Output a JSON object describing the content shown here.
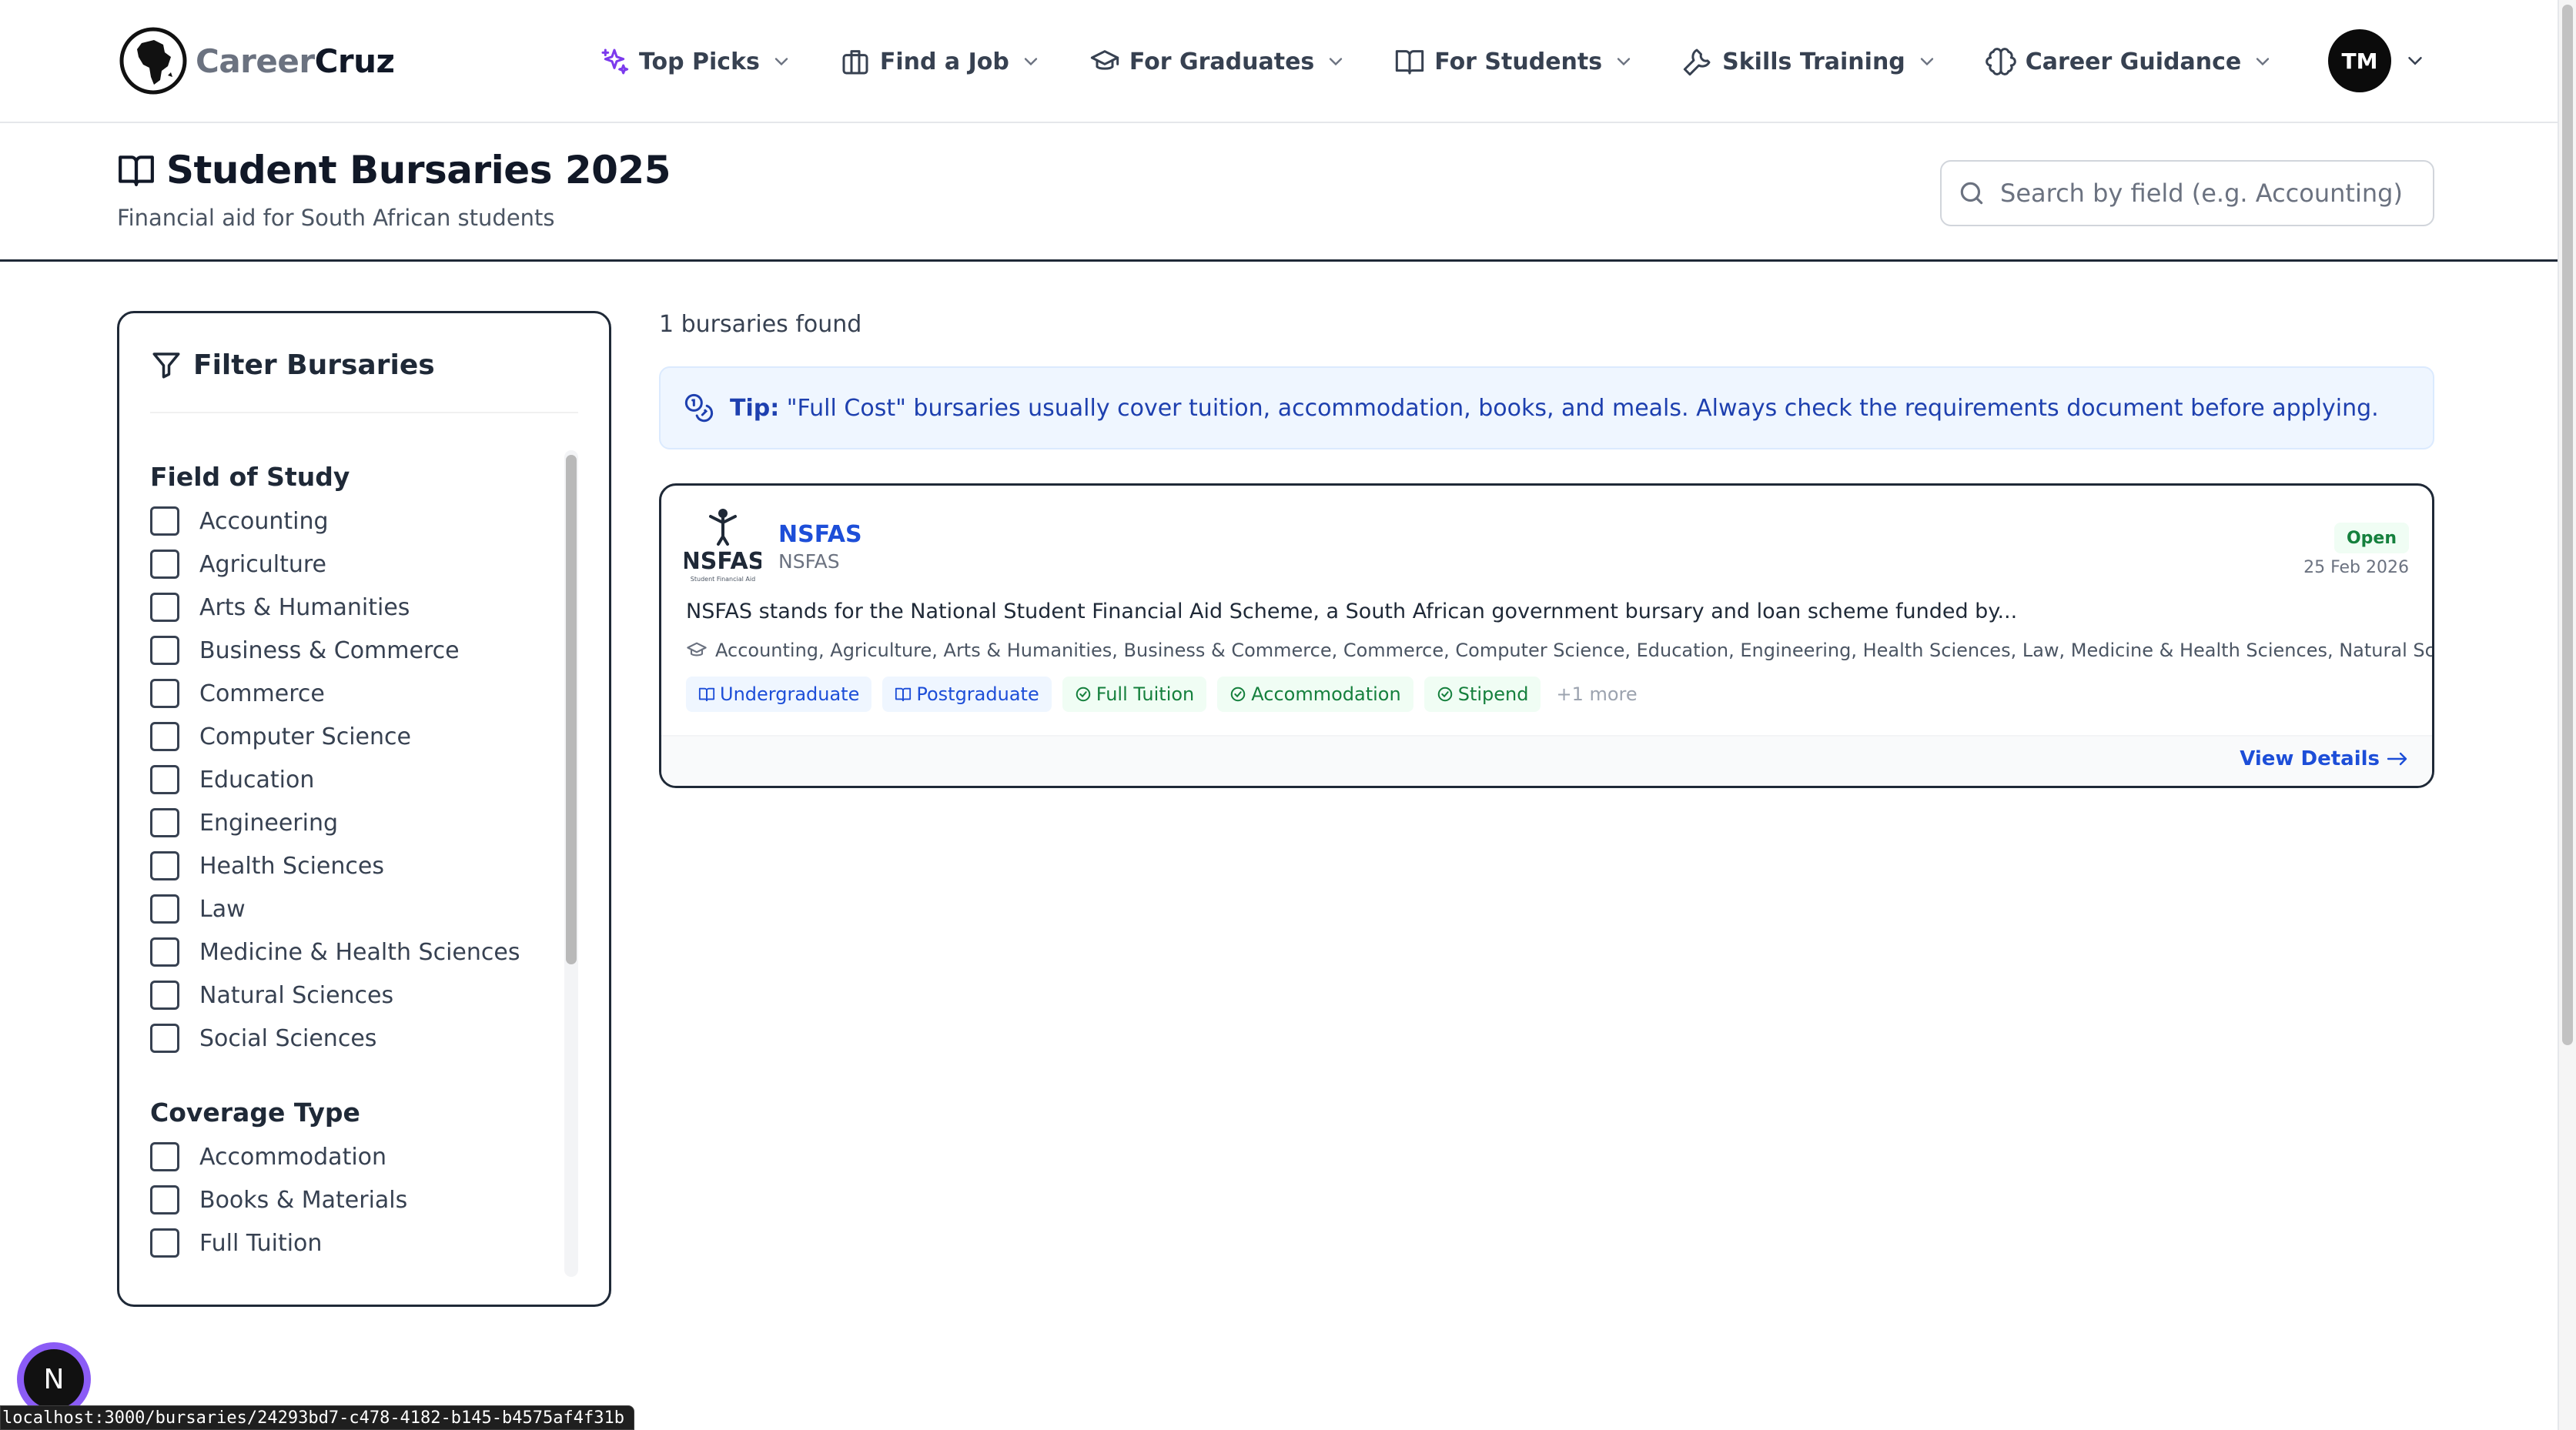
{
  "brand": {
    "name_part1": "Career",
    "name_part2": "Cruz"
  },
  "nav": {
    "items": [
      {
        "label": "Top Picks",
        "icon": "sparkles-icon"
      },
      {
        "label": "Find a Job",
        "icon": "briefcase-icon"
      },
      {
        "label": "For Graduates",
        "icon": "graduation-cap-icon"
      },
      {
        "label": "For Students",
        "icon": "book-open-icon"
      },
      {
        "label": "Skills Training",
        "icon": "wrench-icon"
      },
      {
        "label": "Career Guidance",
        "icon": "brain-icon"
      }
    ]
  },
  "user": {
    "initials": "TM"
  },
  "page": {
    "title": "Student Bursaries 2025",
    "subtitle": "Financial aid for South African students"
  },
  "search": {
    "placeholder": "Search by field (e.g. Accounting)",
    "value": ""
  },
  "filters": {
    "title": "Filter Bursaries",
    "groups": [
      {
        "title": "Field of Study",
        "options": [
          "Accounting",
          "Agriculture",
          "Arts & Humanities",
          "Business & Commerce",
          "Commerce",
          "Computer Science",
          "Education",
          "Engineering",
          "Health Sciences",
          "Law",
          "Medicine & Health Sciences",
          "Natural Sciences",
          "Social Sciences"
        ]
      },
      {
        "title": "Coverage Type",
        "options": [
          "Accommodation",
          "Books & Materials",
          "Full Tuition"
        ]
      }
    ]
  },
  "results": {
    "count_text": "1 bursaries found"
  },
  "tip": {
    "label": "Tip:",
    "text": " \"Full Cost\" bursaries usually cover tuition, accommodation, books, and meals. Always check the requirements document before applying."
  },
  "bursary": {
    "name": "NSFAS",
    "provider": "NSFAS",
    "status": "Open",
    "date": "25 Feb 2026",
    "description": "NSFAS stands for the National Student Financial Aid Scheme, a South African government bursary and loan scheme funded by...",
    "fields": "Accounting, Agriculture, Arts & Humanities, Business & Commerce, Commerce, Computer Science, Education, Engineering, Health Sciences, Law, Medicine & Health Sciences, Natural Sciences, Social...",
    "level_tags": [
      "Undergraduate",
      "Postgraduate"
    ],
    "coverage_tags": [
      "Full Tuition",
      "Accommodation",
      "Stipend"
    ],
    "more": "+1 more",
    "view_details": "View Details"
  },
  "logo_text": {
    "nsfas_mark": "NSFAS",
    "nsfas_tagline": "Student Financial Aid"
  },
  "dev_badge": {
    "letter": "N"
  },
  "status_bar": {
    "url": "localhost:3000/bursaries/24293bd7-c478-4182-b145-b4575af4f31b"
  },
  "colors": {
    "accent_blue": "#1d4ed8",
    "tip_bg": "#eff6ff",
    "open_green": "#15803d",
    "nav_icon_purple": "#7c3aed"
  }
}
